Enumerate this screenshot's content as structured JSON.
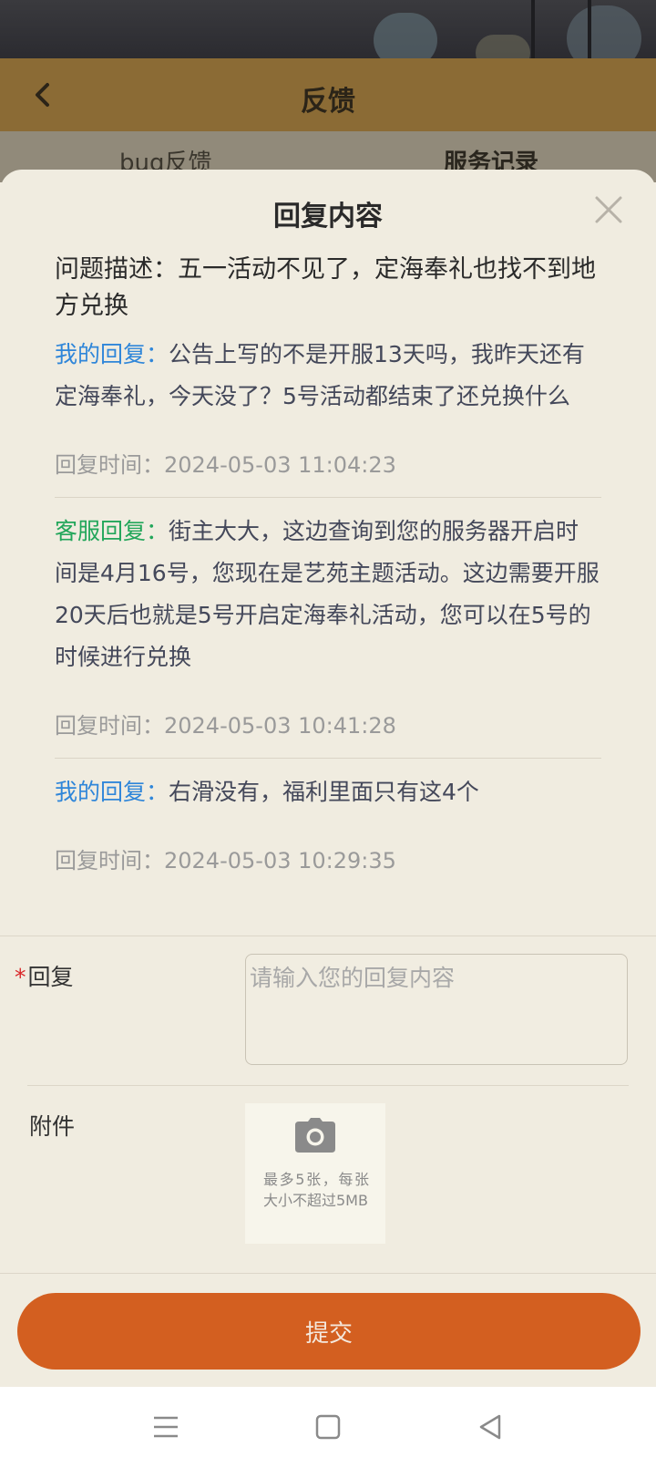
{
  "header": {
    "title": "反馈"
  },
  "tabs": [
    {
      "label": "bug反馈"
    },
    {
      "label": "服务记录"
    }
  ],
  "modal": {
    "title": "回复内容",
    "problem": "问题描述：五一活动不见了，定海奉礼也找不到地方兑换",
    "replies": [
      {
        "type": "mine",
        "label": "我的回复：",
        "text": "公告上写的不是开服13天吗，我昨天还有定海奉礼，今天没了？5号活动都结束了还兑换什么",
        "time_label": "回复时间：",
        "time": "2024-05-03 11:04:23"
      },
      {
        "type": "service",
        "label": "客服回复：",
        "text": "街主大大，这边查询到您的服务器开启时间是4月16号，您现在是艺苑主题活动。这边需要开服20天后也就是5号开启定海奉礼活动，您可以在5号的时候进行兑换",
        "time_label": "回复时间：",
        "time": "2024-05-03 10:41:28"
      },
      {
        "type": "mine",
        "label": "我的回复：",
        "text": "右滑没有，福利里面只有这4个",
        "time_label": "回复时间：",
        "time": "2024-05-03 10:29:35"
      }
    ]
  },
  "form": {
    "reply_required_mark": "*",
    "reply_label": "回复",
    "reply_placeholder": "请输入您的回复内容",
    "attachment_label": "附件",
    "upload_hint": "最多5张，每张大小不超过5MB",
    "submit_label": "提交"
  },
  "colors": {
    "accent_submit": "#d35f20",
    "my_reply_label": "#2f86d9",
    "service_reply_label": "#22a65a",
    "header_bg": "#8b6b35"
  },
  "icons": {
    "back": "chevron-left-icon",
    "close": "close-icon",
    "camera": "camera-icon",
    "nav": [
      "menu-icon",
      "home-square-icon",
      "back-triangle-icon"
    ]
  }
}
